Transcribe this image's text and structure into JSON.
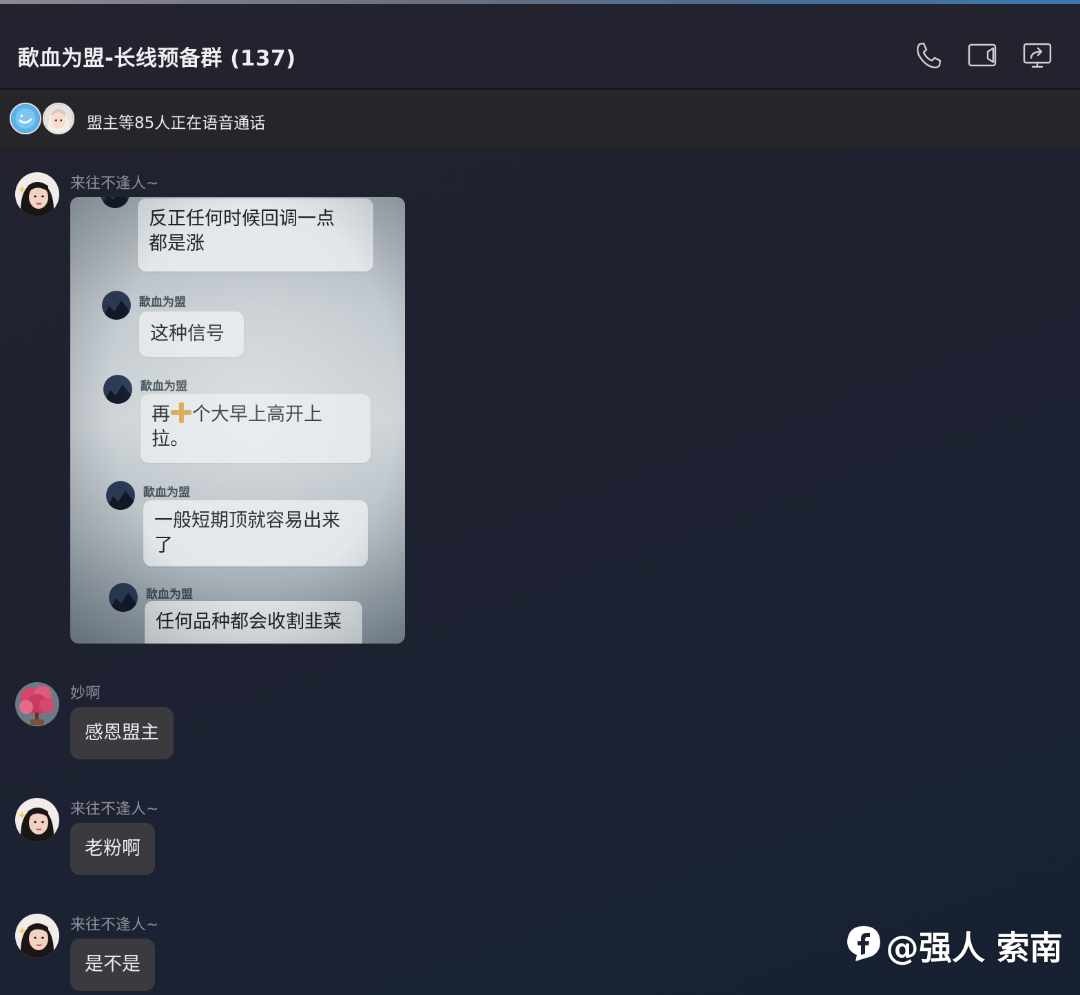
{
  "header": {
    "title": "歃血为盟-长线预备群 (137)",
    "icons": [
      "phone-icon",
      "video-camera-icon",
      "screen-share-icon"
    ]
  },
  "voice_call_bar": {
    "text": "盟主等85人正在语音通话"
  },
  "messages": [
    {
      "sender": "来往不逢人~",
      "type": "image",
      "image": {
        "bubbles": [
          {
            "name": "",
            "text_lines": [
              "反正任何时候回调一点",
              "都是涨"
            ]
          },
          {
            "name": "歃血为盟",
            "text_lines": [
              "这种信号"
            ]
          },
          {
            "name": "歃血为盟",
            "text_before_emoji": "再",
            "emoji": "cross",
            "text_after_emoji": "个大早上高开上",
            "text_line2": "拉。"
          },
          {
            "name": "歃血为盟",
            "text_lines": [
              "一般短期顶就容易出来",
              "了"
            ]
          },
          {
            "name": "歃血为盟",
            "text_lines": [
              "任何品种都会收割韭菜"
            ]
          }
        ]
      }
    },
    {
      "sender": "妙啊",
      "type": "text",
      "text": "感恩盟主"
    },
    {
      "sender": "来往不逢人~",
      "type": "text",
      "text": "老粉啊"
    },
    {
      "sender": "来往不逢人~",
      "type": "text",
      "text": "是不是"
    }
  ],
  "watermark": {
    "text": "@强人 索南",
    "logo_icon": "platform-logo-icon"
  },
  "colors": {
    "background": "#22222e",
    "bubble": "#3a3a3f",
    "sender_name": "#8e8e98",
    "title": "#f0f0f3"
  }
}
